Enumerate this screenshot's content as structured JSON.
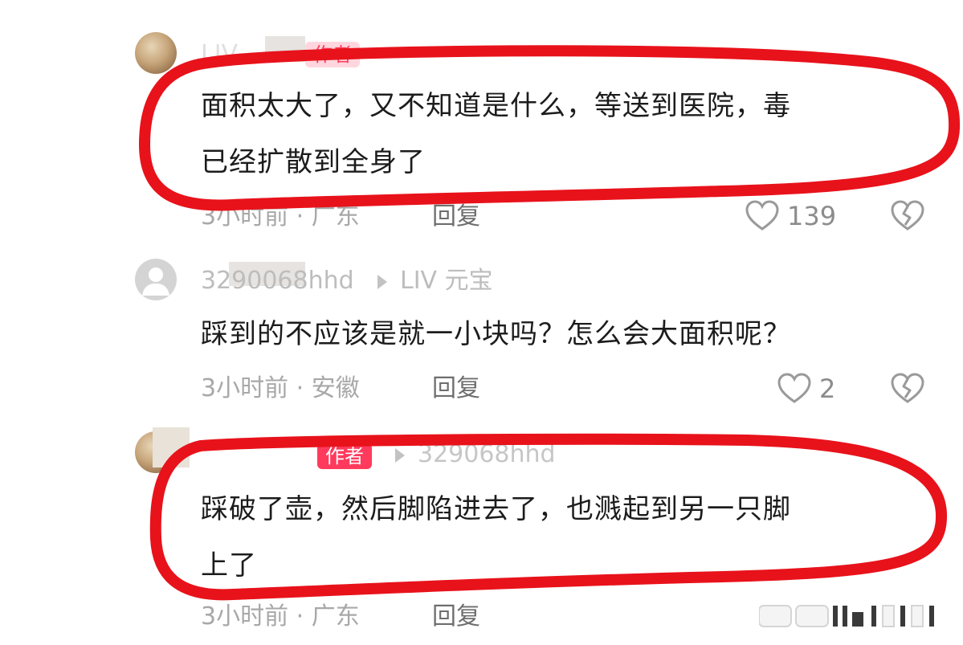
{
  "top_partial": {
    "text": ""
  },
  "comments": [
    {
      "username": "LIV",
      "badge": "作者",
      "text_line1": "面积太大了，又不知道是什么，等送到医院，毒",
      "text_line2": "已经扩散到全身了",
      "meta": "3小时前 · 广东",
      "reply_label": "回复",
      "like_count": "139"
    },
    {
      "username": "3290068hhd",
      "reply_to": "LIV 元宝",
      "text_line1": "踩到的不应该是就一小块吗？怎么会大面积呢？",
      "meta": "3小时前 · 安徽",
      "reply_label": "回复",
      "like_count": "2"
    },
    {
      "badge": "作者",
      "reply_to": "329068hhd",
      "text_line1": "踩破了壶，然后脚陷进去了，也溅起到另一只脚",
      "text_line2": "上了",
      "meta": "3小时前 · 广东",
      "reply_label": "回复"
    }
  ],
  "colors": {
    "highlight": "#e8121b",
    "badge": "#ff3a5c"
  },
  "icons": [
    "heart-icon",
    "broken-heart-icon",
    "triangle-right-icon",
    "default-avatar-icon"
  ]
}
